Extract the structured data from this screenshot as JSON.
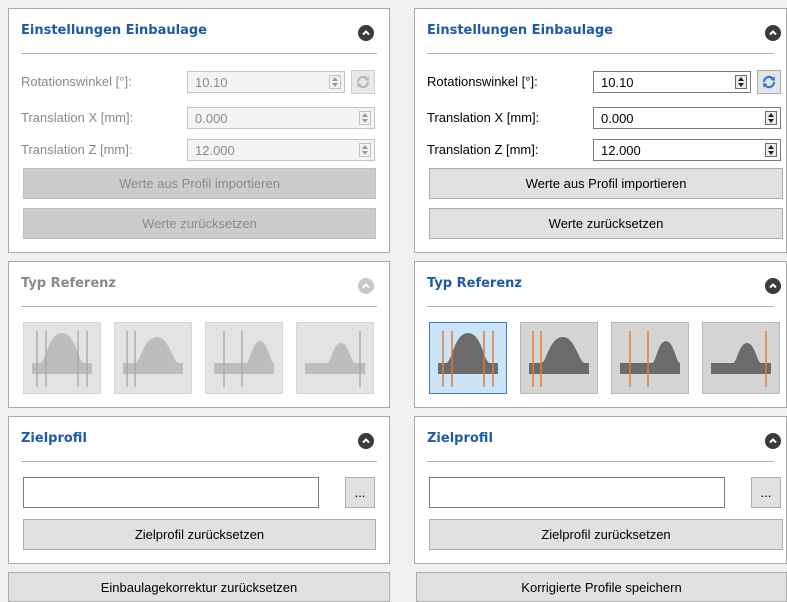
{
  "left": {
    "settings": {
      "title": "Einstellungen Einbaulage",
      "rotation_label": "Rotationswinkel [°]:",
      "rotation_value": "10.10",
      "tx_label": "Translation X [mm]:",
      "tx_value": "0.000",
      "tz_label": "Translation Z [mm]:",
      "tz_value": "12.000",
      "import_button": "Werte aus Profil importieren",
      "reset_button": "Werte zurücksetzen",
      "enabled": false
    },
    "reference": {
      "title": "Typ Referenz",
      "enabled": false
    },
    "target": {
      "title": "Zielprofil",
      "input_value": "",
      "browse_label": "...",
      "reset_button": "Zielprofil zurücksetzen"
    },
    "footer_button": "Einbaulagekorrektur zurücksetzen"
  },
  "right": {
    "settings": {
      "title": "Einstellungen Einbaulage",
      "rotation_label": "Rotationswinkel [°]:",
      "rotation_value": "10.10",
      "tx_label": "Translation X [mm]:",
      "tx_value": "0.000",
      "tz_label": "Translation Z [mm]:",
      "tz_value": "12.000",
      "import_button": "Werte aus Profil importieren",
      "reset_button": "Werte zurücksetzen",
      "enabled": true
    },
    "reference": {
      "title": "Typ Referenz",
      "enabled": true,
      "selected_index": 0
    },
    "target": {
      "title": "Zielprofil",
      "input_value": "",
      "browse_label": "...",
      "reset_button": "Zielprofil zurücksetzen"
    },
    "footer_button": "Korrigierte Profile speichern"
  },
  "icons": {
    "collapse": "chevron-up-icon",
    "refresh": "refresh-icon",
    "reference_types": [
      "reference-type-1-icon",
      "reference-type-2-icon",
      "reference-type-3-icon",
      "reference-type-4-icon"
    ]
  },
  "colors": {
    "title": "#1e5aa8",
    "disabled_text": "#8a8a8a",
    "reference_line": "#e07b39",
    "selected_tile": "#cce4f7",
    "refresh_icon": "#2a7bd6"
  }
}
